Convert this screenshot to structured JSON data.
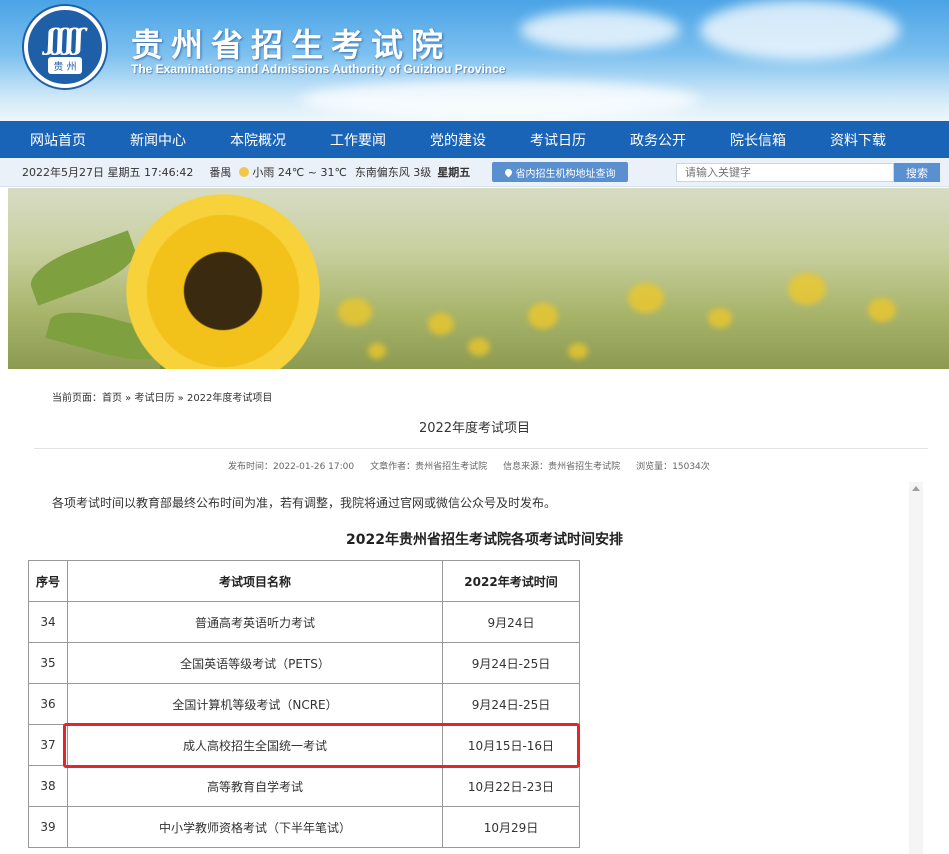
{
  "header": {
    "logo_seal": "贵 州",
    "logo_mark": "ʃʃʃʃ",
    "title": "贵州省招生考试院",
    "subtitle": "The Examinations and Admissions Authority of Guizhou Province"
  },
  "nav": {
    "items": [
      "网站首页",
      "新闻中心",
      "本院概况",
      "工作要闻",
      "党的建设",
      "考试日历",
      "政务公开",
      "院长信箱",
      "资料下载"
    ]
  },
  "infobar": {
    "date": "2022年5月27日 星期五 17:46:42",
    "city": "番禺",
    "weather": "小雨 24℃ ~ 31℃",
    "wind": "东南偏东风 3级",
    "weekday": "星期五",
    "address_button": "省内招生机构地址查询",
    "search_placeholder": "请输入关键字",
    "search_button": "搜索"
  },
  "breadcrumb": "当前页面：首页 » 考试日历 » 2022年度考试项目",
  "article": {
    "title": "2022年度考试项目",
    "publish_time": "发布时间：2022-01-26 17:00",
    "author": "文章作者：贵州省招生考试院",
    "source": "信息来源：贵州省招生考试院",
    "views": "浏览量：15034次",
    "notice": "各项考试时间以教育部最终公布时间为准，若有调整，我院将通过官网或微信公众号及时发布。",
    "table_title": "2022年贵州省招生考试院各项考试时间安排"
  },
  "table": {
    "headers": [
      "序号",
      "考试项目名称",
      "2022年考试时间"
    ],
    "rows": [
      [
        "34",
        "普通高考英语听力考试",
        "9月24日"
      ],
      [
        "35",
        "全国英语等级考试（PETS）",
        "9月24日-25日"
      ],
      [
        "36",
        "全国计算机等级考试（NCRE）",
        "9月24日-25日"
      ],
      [
        "37",
        "成人高校招生全国统一考试",
        "10月15日-16日"
      ],
      [
        "38",
        "高等教育自学考试",
        "10月22日-23日"
      ],
      [
        "39",
        "中小学教师资格考试（下半年笔试）",
        "10月29日"
      ]
    ],
    "highlight_color": "#e4262b"
  },
  "colors": {
    "nav_bg": "#1a64b7",
    "infobar_bg": "#eaf1f8",
    "accent": "#5a8fd0"
  }
}
